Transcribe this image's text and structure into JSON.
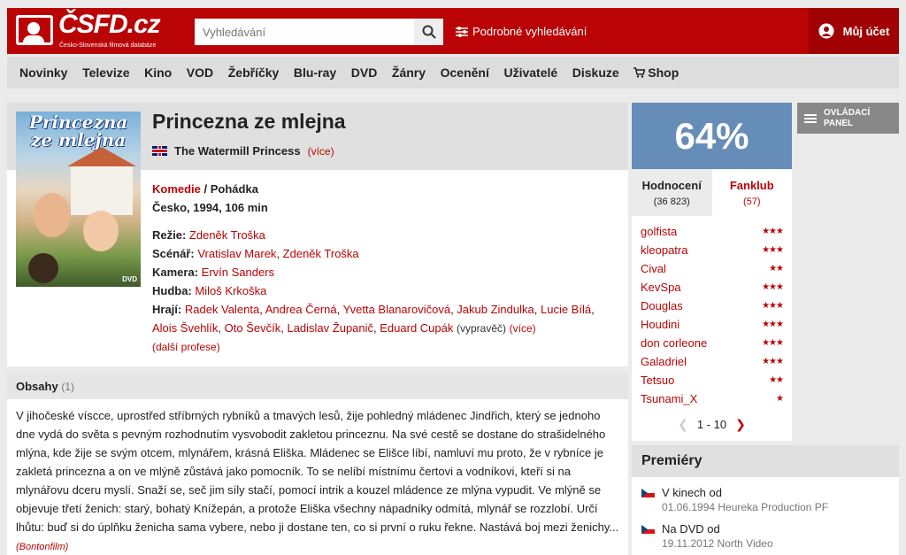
{
  "header": {
    "logo_brand": "ČSFD.cz",
    "logo_tagline": "Česko-Slovenská filmová databáze",
    "search_placeholder": "Vyhledávání",
    "advanced_search": "Podrobné vyhledávání",
    "account": "Můj účet"
  },
  "nav": [
    "Novinky",
    "Televize",
    "Kino",
    "VOD",
    "Žebříčky",
    "Blu-ray",
    "DVD",
    "Žánry",
    "Ocenění",
    "Uživatelé",
    "Diskuze",
    "Shop"
  ],
  "film": {
    "poster_title": "Princezna ze mlejna",
    "title": "Princezna ze mlejna",
    "alt_title": "The Watermill Princess",
    "alt_more": "(více)",
    "genre_primary": "Komedie",
    "genre_sep": " / ",
    "genre_secondary": "Pohádka",
    "origin": "Česko, 1994, 106 min",
    "crew": {
      "directing_label": "Režie:",
      "directing": "Zdeněk Troška",
      "writing_label": "Scénář:",
      "writing": [
        "Vratislav Marek",
        "Zdeněk Troška"
      ],
      "camera_label": "Kamera:",
      "camera": "Ervín Sanders",
      "music_label": "Hudba:",
      "music": "Miloš Krkoška",
      "cast_label": "Hrají:",
      "cast": [
        "Radek Valenta",
        "Andrea Černá",
        "Yvetta Blanarovičová",
        "Jakub Zindulka",
        "Lucie Bílá",
        "Alois Švehlík",
        "Oto Ševčík",
        "Ladislav Županič",
        "Eduard Cupák"
      ],
      "narrator_note": "(vypravěč)",
      "cast_more": "(více)",
      "more_professions": "(další profese)"
    }
  },
  "synopsis": {
    "heading": "Obsahy",
    "count": "(1)",
    "text": "V jihočeské víscce, uprostřed stříbrných rybníků a tmavých lesů, žije pohledný mládenec Jindřich, který se jednoho dne vydá do světa s pevným rozhodnutím vysvobodit zakletou princeznu. Na své cestě se dostane do strašidelného mlýna, kde žije se svým otcem, mlynářem, krásná Eliška. Mládenec se Elišce líbí, namluví mu proto, že v rybníce je zakletá princezna a on ve mlýně zůstává jako pomocník. To se nelíbí místnímu čertovi a vodníkovi, kteří si na mlynářovu dceru myslí. Snaží se, seč jim síly stačí, pomocí intrik a kouzel mládence ze mlýna vypudit. Ve mlýně se objevuje třetí ženich: starý, bohatý Knížepán, a protože Eliška všechny nápadníky odmítá, mlynář se rozzlobí. Určí lhůtu: buď si do úplňku ženicha sama vybere, nebo ji dostane ten, co si první o ruku řekne. Nastává boj mezi ženichy...",
    "source": "(Bontonfilm)"
  },
  "rating": {
    "percent": "64%",
    "tab_ratings": "Hodnocení",
    "tab_ratings_count": "(36 823)",
    "tab_fanclub": "Fanklub",
    "tab_fanclub_count": "(57)",
    "users": [
      {
        "name": "golfista",
        "stars": "★★★"
      },
      {
        "name": "kleopatra",
        "stars": "★★★"
      },
      {
        "name": "Cival",
        "stars": "★★"
      },
      {
        "name": "KevSpa",
        "stars": "★★★"
      },
      {
        "name": "Douglas",
        "stars": "★★★"
      },
      {
        "name": "Houdini",
        "stars": "★★★"
      },
      {
        "name": "don corleone",
        "stars": "★★★"
      },
      {
        "name": "Galadriel",
        "stars": "★★★"
      },
      {
        "name": "Tetsuo",
        "stars": "★★"
      },
      {
        "name": "Tsunami_X",
        "stars": "★"
      }
    ],
    "pager": "1 - 10"
  },
  "control_panel": {
    "line1": "OVLÁDACÍ",
    "line2": "PANEL"
  },
  "premieres": {
    "heading": "Premiéry",
    "rows": [
      {
        "label": "V kinech od",
        "sub": "01.06.1994 Heureka Production PF"
      },
      {
        "label": "Na DVD od",
        "sub": "19.11.2012 North Video"
      }
    ]
  },
  "colors": {
    "accent": "#ba0305",
    "rating": "#658db7"
  }
}
